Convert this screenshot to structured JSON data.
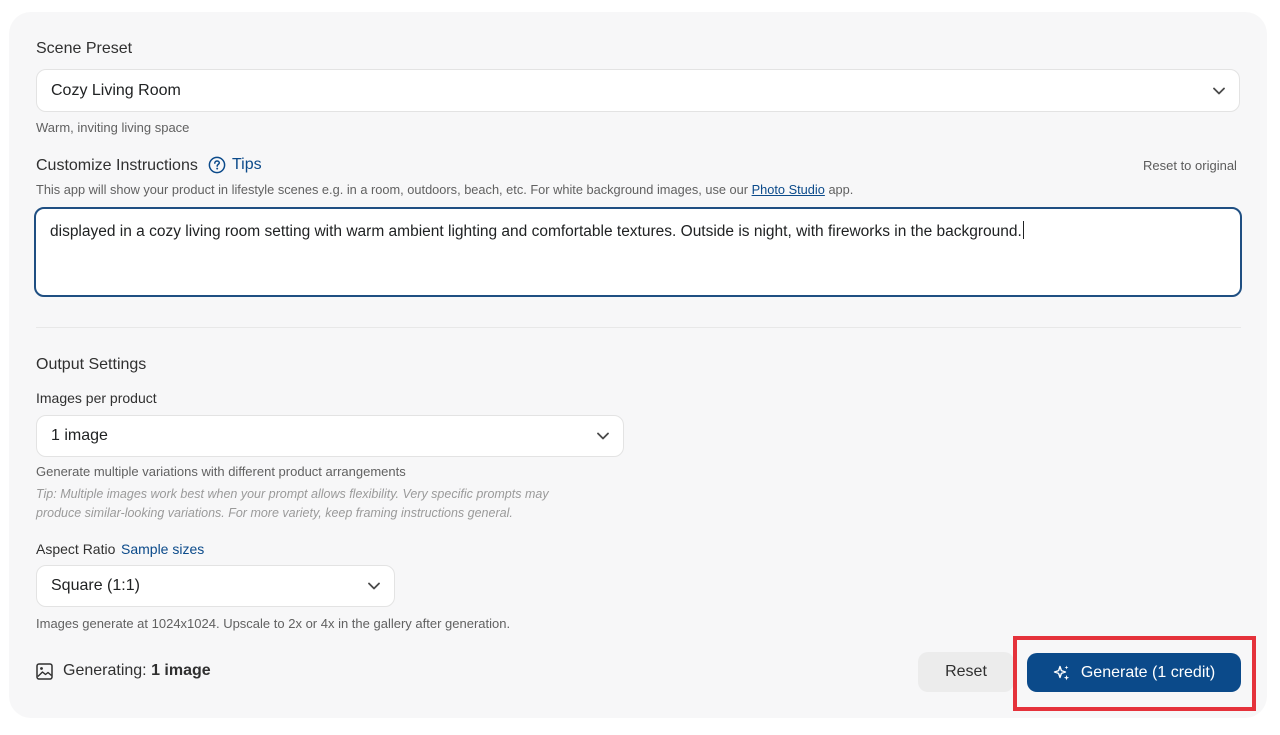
{
  "scene_preset": {
    "label": "Scene Preset",
    "selected": "Cozy Living Room",
    "description": "Warm, inviting living space"
  },
  "customize": {
    "label": "Customize Instructions",
    "tips_label": "Tips",
    "reset_label": "Reset to original",
    "help_prefix": "This app will show your product in lifestyle scenes e.g. in a room, outdoors, beach, etc. For white background images, use our",
    "help_link": "Photo Studio",
    "help_suffix": "app.",
    "instructions": "displayed in a cozy living room setting with warm ambient lighting and comfortable textures. Outside is night, with fireworks in the background."
  },
  "output": {
    "title": "Output Settings",
    "images_label": "Images per product",
    "images_selected": "1 image",
    "images_help": "Generate multiple variations with different product arrangements",
    "tip_line1": "Tip: Multiple images work best when your prompt allows flexibility. Very specific prompts may",
    "tip_line2": "produce similar-looking variations. For more variety, keep framing instructions general.",
    "aspect_label": "Aspect Ratio",
    "sample_sizes_label": "Sample sizes",
    "aspect_selected": "Square (1:1)",
    "aspect_help": "Images generate at 1024x1024. Upscale to 2x or 4x in the gallery after generation."
  },
  "footer": {
    "generating_label": "Generating:",
    "generating_value": "1 image",
    "reset_label": "Reset",
    "generate_label": "Generate (1 credit)"
  },
  "colors": {
    "primary": "#0b4a8a",
    "highlight": "#e5323b",
    "panel_bg": "#f7f7f8"
  }
}
